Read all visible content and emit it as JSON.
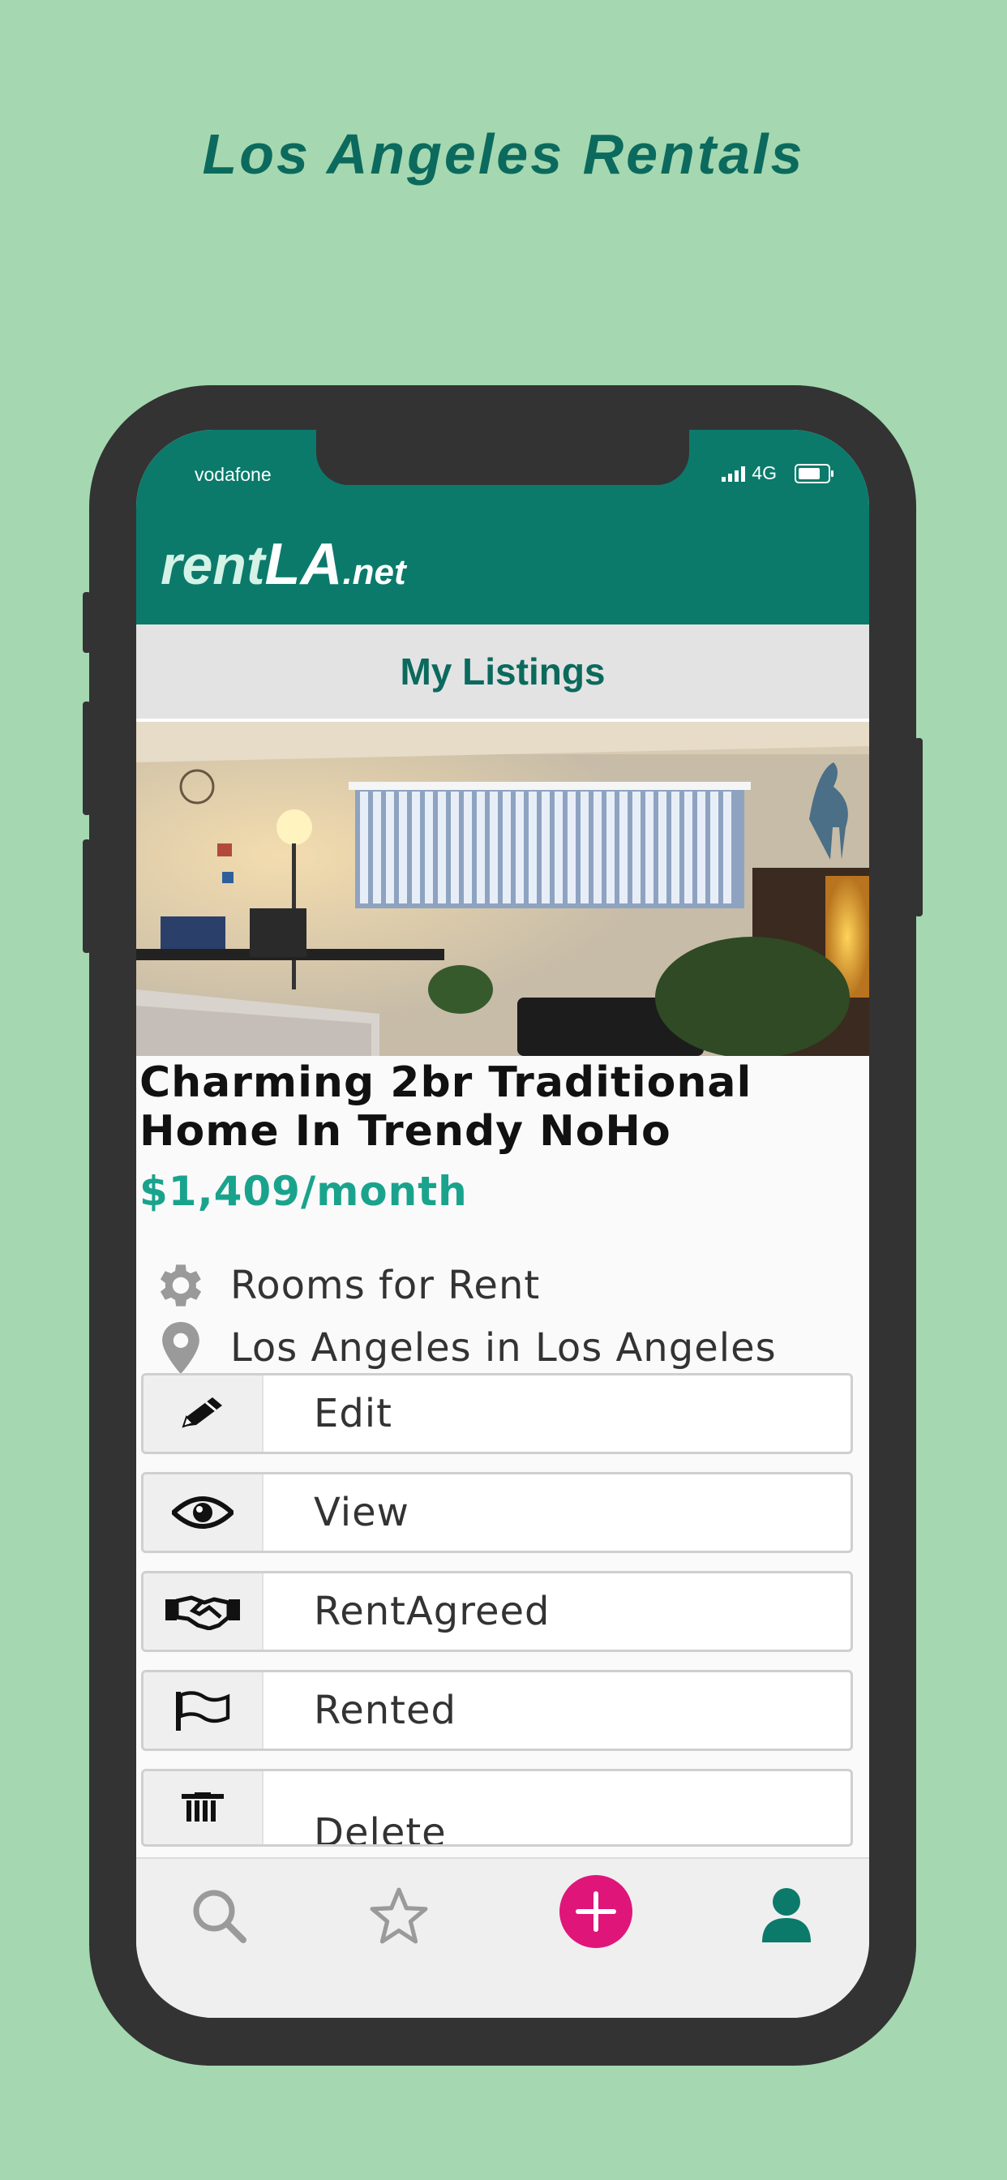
{
  "promo": {
    "title": "Los Angeles Rentals"
  },
  "status_bar": {
    "carrier": "vodafone",
    "network": "4G"
  },
  "app": {
    "logo_part1": "rent",
    "logo_part2": "LA",
    "logo_part3": ".net"
  },
  "page": {
    "title": "My Listings"
  },
  "listing": {
    "title": "Charming 2br Traditional Home In Trendy NoHo",
    "price": "$1,409/month",
    "category": "Rooms for Rent",
    "location": "Los Angeles in Los Angeles"
  },
  "actions": [
    {
      "label": "Edit",
      "icon": "pencil-icon"
    },
    {
      "label": "View",
      "icon": "eye-icon"
    },
    {
      "label": "RentAgreed",
      "icon": "handshake-icon"
    },
    {
      "label": "Rented",
      "icon": "flag-icon"
    },
    {
      "label": "Delete",
      "icon": "trash-icon"
    }
  ],
  "tabbar": {
    "items": [
      "search-icon",
      "star-icon",
      "add-icon",
      "profile-icon"
    ],
    "accent_color": "#e0157a",
    "active_color": "#0b7a6b"
  },
  "colors": {
    "background": "#a5d8b0",
    "brand": "#0b7a6b",
    "price": "#1aa38c"
  }
}
